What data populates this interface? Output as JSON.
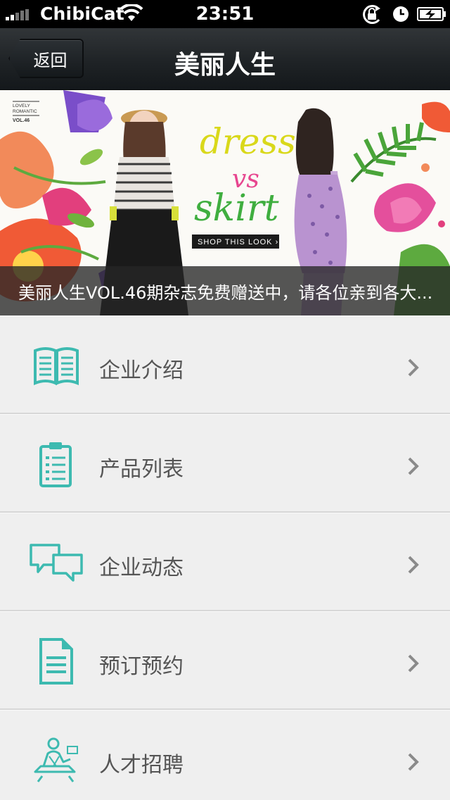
{
  "status_bar": {
    "carrier": "ChibiCat",
    "time": "23:51",
    "icons": [
      "signal-icon",
      "wifi-icon",
      "rotation-lock-icon",
      "alarm-icon",
      "battery-charging-icon"
    ]
  },
  "nav": {
    "back_label": "返回",
    "title": "美丽人生"
  },
  "banner": {
    "brand_line1": "LOVELY",
    "brand_line2": "ROMANTIC",
    "brand_vol": "VOL.46",
    "headline_top": "dress",
    "headline_mid": "vs",
    "headline_bottom": "skirt",
    "cta": "SHOP THIS LOOK ›",
    "caption": "美丽人生VOL.46期杂志免费赠送中，请各位亲到各大..."
  },
  "menu": {
    "items": [
      {
        "label": "企业介绍",
        "icon": "open-book-icon"
      },
      {
        "label": "产品列表",
        "icon": "clipboard-list-icon"
      },
      {
        "label": "企业动态",
        "icon": "chat-bubbles-icon"
      },
      {
        "label": "预订预约",
        "icon": "document-icon"
      },
      {
        "label": "人才招聘",
        "icon": "person-desk-icon"
      }
    ]
  },
  "colors": {
    "accent_teal": "#3dbab0",
    "nav_dark": "#1f2326",
    "list_bg": "#efefef",
    "headline_yellow": "#d9d81a",
    "headline_green": "#3fae3f",
    "headline_pink": "#e7458f"
  }
}
